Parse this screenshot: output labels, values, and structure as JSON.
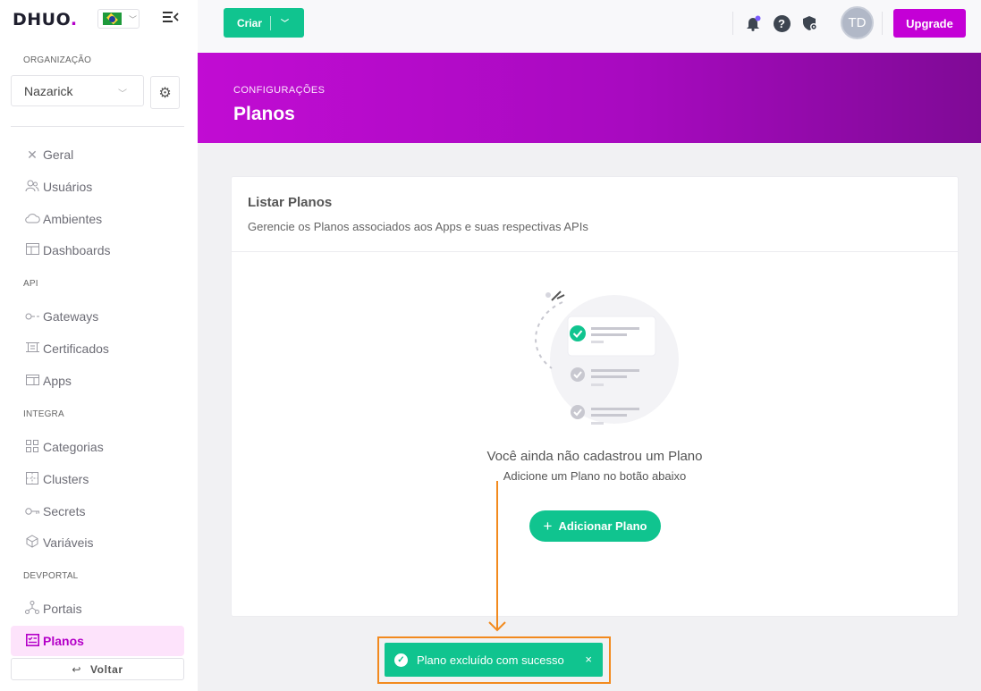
{
  "brand": {
    "logo_text": "DHUO",
    "logo_dot": "."
  },
  "sidebar": {
    "org_label": "ORGANIZAÇÃO",
    "org_value": "Nazarick",
    "items": [
      {
        "label": "Geral",
        "icon": "tools-icon"
      },
      {
        "label": "Usuários",
        "icon": "users-icon"
      },
      {
        "label": "Ambientes",
        "icon": "cloud-icon"
      },
      {
        "label": "Dashboards",
        "icon": "dashboard-icon"
      },
      {
        "label": "Gateways",
        "icon": "gateway-icon"
      },
      {
        "label": "Certificados",
        "icon": "certificate-icon"
      },
      {
        "label": "Apps",
        "icon": "apps-icon"
      },
      {
        "label": "Categorias",
        "icon": "categories-icon"
      },
      {
        "label": "Clusters",
        "icon": "clusters-icon"
      },
      {
        "label": "Secrets",
        "icon": "key-icon"
      },
      {
        "label": "Variáveis",
        "icon": "variables-icon"
      },
      {
        "label": "Portais",
        "icon": "portal-icon"
      },
      {
        "label": "Planos",
        "icon": "plans-icon",
        "active": true
      }
    ],
    "sections": {
      "api": "API",
      "integra": "INTEGRA",
      "devportal": "DEVPORTAL"
    },
    "back_label": "Voltar"
  },
  "topbar": {
    "create_label": "Criar",
    "avatar_initials": "TD",
    "upgrade_label": "Upgrade"
  },
  "banner": {
    "crumb": "CONFIGURAÇÕES",
    "title": "Planos"
  },
  "card": {
    "title": "Listar Planos",
    "subtitle": "Gerencie os Planos associados aos Apps e suas respectivas APIs",
    "empty_title": "Você ainda não cadastrou um Plano",
    "empty_subtitle": "Adicione um Plano no botão abaixo",
    "add_label": "Adicionar Plano"
  },
  "toast": {
    "message": "Plano excluído com sucesso",
    "close": "×"
  },
  "colors": {
    "primary": "#10c48f",
    "brand": "#c400d6",
    "annotation": "#f28a1e"
  }
}
